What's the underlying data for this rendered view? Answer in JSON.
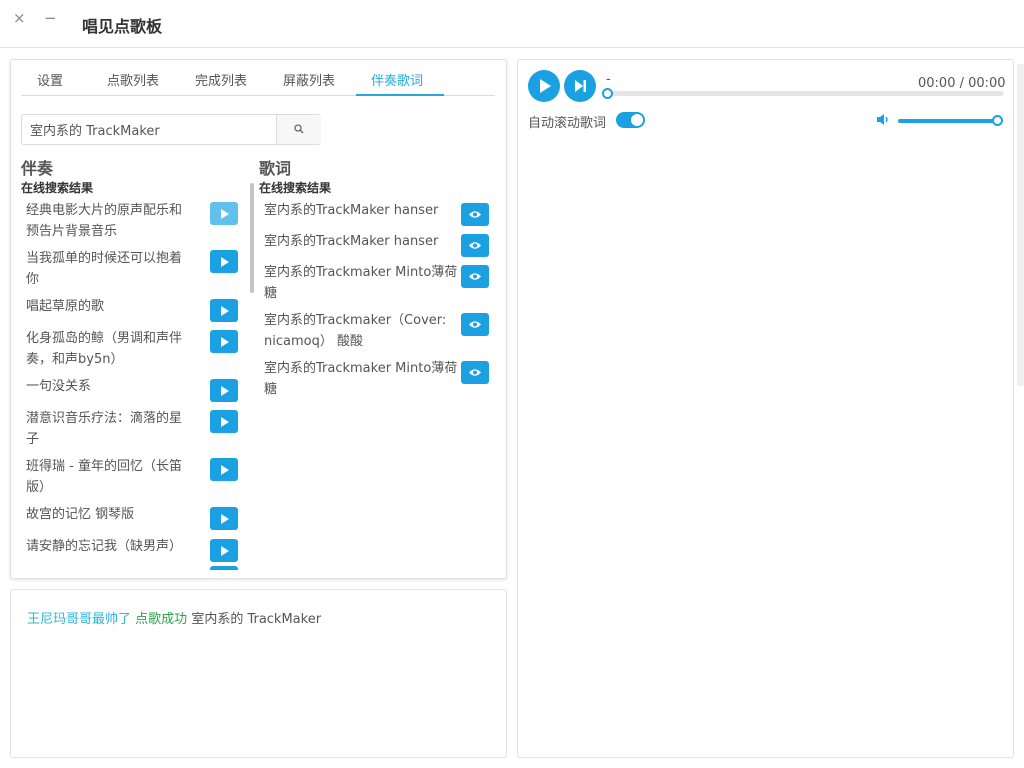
{
  "window": {
    "title": "唱见点歌板",
    "close_glyph": "×",
    "minimize_glyph": "−"
  },
  "tabs": [
    {
      "label": "设置",
      "active": false
    },
    {
      "label": "点歌列表",
      "active": false
    },
    {
      "label": "完成列表",
      "active": false
    },
    {
      "label": "屏蔽列表",
      "active": false
    },
    {
      "label": "伴奏歌词",
      "active": true
    }
  ],
  "search": {
    "value": "室内系的 TrackMaker",
    "icon": "search-icon"
  },
  "accompaniment": {
    "heading": "伴奏",
    "subheading": "在线搜索结果",
    "items": [
      {
        "line1": "经典电影大片的原声配乐和",
        "line2": "预告片背景音乐"
      },
      {
        "line1": "当我孤单的时候还可以抱着",
        "line2": "你"
      },
      {
        "line1": "唱起草原的歌",
        "line2": ""
      },
      {
        "line1": "化身孤岛的鲸（男调和声伴",
        "line2": "奏，和声by5n）"
      },
      {
        "line1": "一句没关系",
        "line2": ""
      },
      {
        "line1": "潜意识音乐疗法：滴落的星",
        "line2": "子"
      },
      {
        "line1": "班得瑞 - 童年的回忆（长笛",
        "line2": "版）"
      },
      {
        "line1": "故宫的记忆 钢琴版",
        "line2": ""
      },
      {
        "line1": "请安静的忘记我（缺男声）",
        "line2": ""
      }
    ]
  },
  "lyrics": {
    "heading": "歌词",
    "subheading": "在线搜索结果",
    "items": [
      {
        "line1": "室内系的TrackMaker hanser",
        "line2": ""
      },
      {
        "line1": "室内系的TrackMaker hanser",
        "line2": ""
      },
      {
        "line1": "室内系的Trackmaker Minto薄荷",
        "line2": "糖"
      },
      {
        "line1": "室内系的Trackmaker（Cover:",
        "line2": "nicamoq） 酸酸"
      },
      {
        "line1": "室内系的Trackmaker Minto薄荷",
        "line2": "糖"
      }
    ]
  },
  "log": {
    "user": "王尼玛哥哥最帅了",
    "status": "点歌成功",
    "song": "室内系的 TrackMaker"
  },
  "player": {
    "song_title": "-",
    "time": "00:00 / 00:00",
    "progress_fraction": 0,
    "auto_scroll_label": "自动滚动歌词",
    "auto_scroll_on": true,
    "volume_fraction": 1.0,
    "accent_color": "#1ba1e2"
  }
}
